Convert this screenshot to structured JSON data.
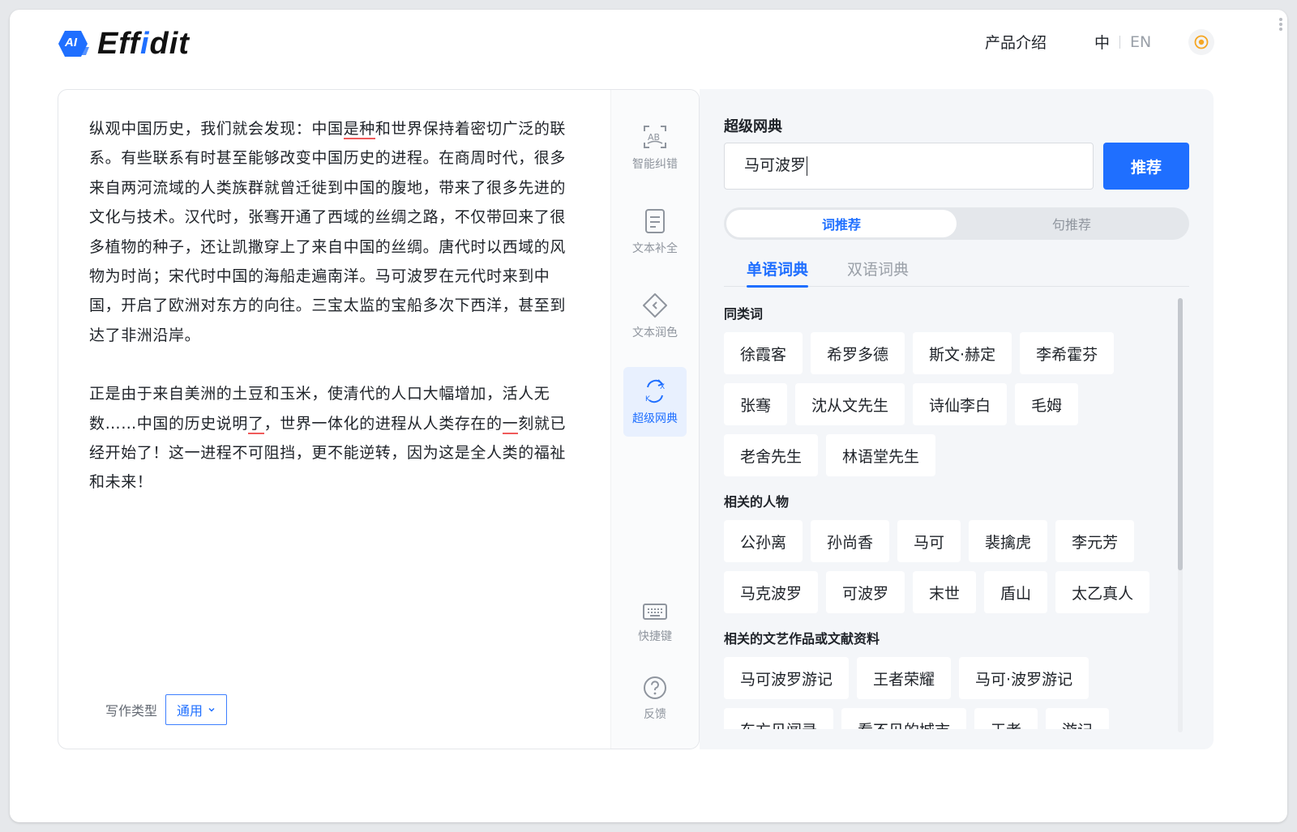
{
  "brand": {
    "ai_mark": "AI",
    "name_pre": "Eff",
    "name_i": "i",
    "name_post": "dit",
    "accent": "#1f6fff"
  },
  "header": {
    "product_link": "产品介绍",
    "lang_zh": "中",
    "lang_en": "EN",
    "theme_icon": "sun-icon"
  },
  "editor": {
    "para1": {
      "a": "纵观中国历史，我们就会发现：中国",
      "err1": "是种",
      "b": "和世界保持着密切广泛的联系。有些联系有时甚至能够改变中国历史的进程。在商周时代，很多来自两河流域的人类族群就曾迁徙到中国的腹地，带来了很多先进的文化与技术。汉代时，张骞开通了西域的丝绸之路，不仅带回来了很多植物的种子，还让凯撒穿上了来自中国的丝绸。唐代时以西域的风物为时尚；宋代时中国的海船走遍南洋。马可波罗在元代时来到中国，开启了欧洲对东方的向往。三宝太监的宝船多次下西洋，甚至到达了非洲沿岸。"
    },
    "para2": {
      "a": "正是由于来自美洲的土豆和玉米，使清代的人口大幅增加，活人无数……中国的历史说明",
      "err1": "了",
      "b": "，世界一体化的进程从人类存在的",
      "err2": "一",
      "c": "刻就已经开始了！这一进程不可阻挡，更不能逆转，因为这是全人类的福祉和未来！"
    },
    "writing_type_label": "写作类型",
    "writing_type_value": "通用",
    "error_underline_color": "#f05a5a"
  },
  "tools": [
    {
      "label": "智能纠错",
      "icon": "spell-check-icon"
    },
    {
      "label": "文本补全",
      "icon": "document-complete-icon"
    },
    {
      "label": "文本润色",
      "icon": "polish-tag-icon"
    },
    {
      "label": "超级网典",
      "icon": "dictionary-icon",
      "active": true
    },
    {
      "label": "快捷键",
      "icon": "keyboard-icon"
    },
    {
      "label": "反馈",
      "icon": "help-circle-icon"
    }
  ],
  "dict": {
    "title": "超级网典",
    "query": "马可波罗",
    "recommend_button": "推荐",
    "mode_word": "词推荐",
    "mode_sentence": "句推荐",
    "tab_mono": "单语词典",
    "tab_bi": "双语词典",
    "sections": [
      {
        "heading": "同类词",
        "chips": [
          "徐霞客",
          "希罗多德",
          "斯文·赫定",
          "李希霍芬",
          "张骞",
          "沈从文先生",
          "诗仙李白",
          "毛姆",
          "老舍先生",
          "林语堂先生"
        ]
      },
      {
        "heading": "相关的人物",
        "chips": [
          "公孙离",
          "孙尚香",
          "马可",
          "裴擒虎",
          "李元芳",
          "马克波罗",
          "可波罗",
          "末世",
          "盾山",
          "太乙真人"
        ]
      },
      {
        "heading": "相关的文艺作品或文献资料",
        "chips": [
          "马可波罗游记",
          "王者荣耀",
          "马可·波罗游记",
          "东方见闻录",
          "看不见的城市",
          "王者",
          "游记"
        ]
      }
    ]
  }
}
